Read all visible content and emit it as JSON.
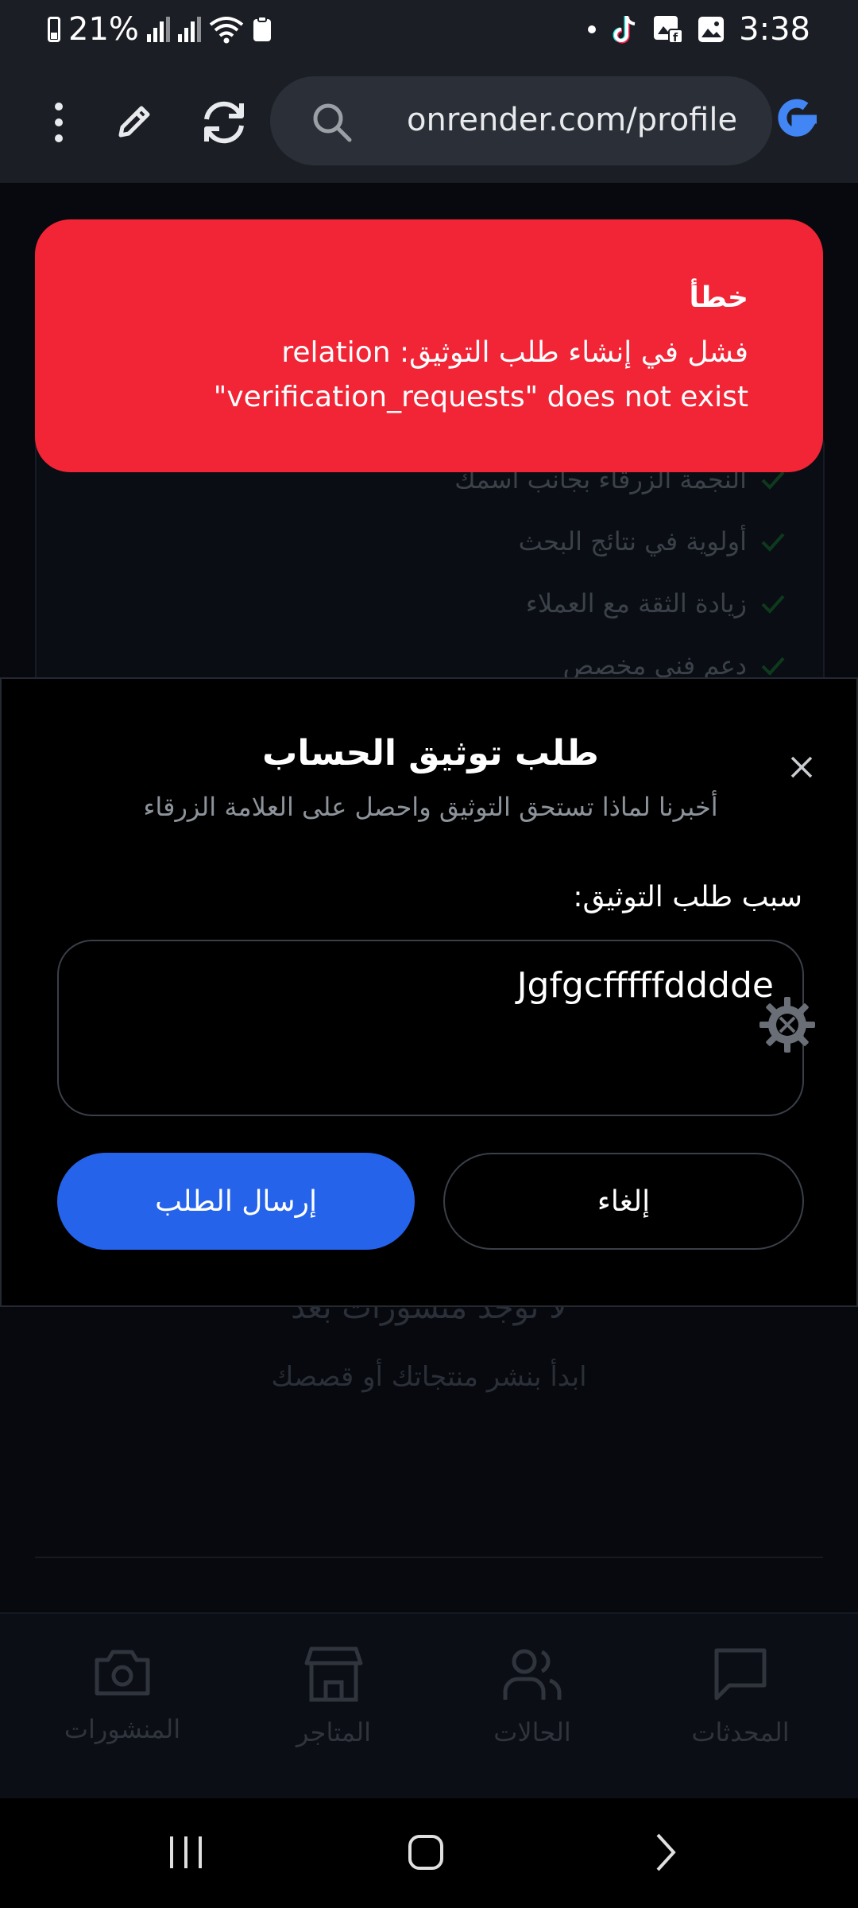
{
  "status_bar": {
    "battery": "21%",
    "time": "3:38",
    "icons": [
      "battery-icon",
      "signal-icon",
      "signal-icon",
      "wifi-icon",
      "clipboard-icon",
      "notification-dot",
      "tiktok-icon",
      "facebook-gallery-icon",
      "gallery-icon"
    ]
  },
  "browser": {
    "url": "onrender.com/profile",
    "icons": [
      "more-vert-icon",
      "edit-pencil-icon",
      "refresh-icon",
      "search-icon",
      "google-icon"
    ]
  },
  "background_page": {
    "benefits": [
      "النجمة الزرقاء بجانب اسمك",
      "أولوية في نتائج البحث",
      "زيادة الثقة مع العملاء",
      "دعم فني مخصص"
    ],
    "empty_title": "لا توجد منشورات بعد",
    "empty_subtitle": "ابدأ بنشر منتجاتك أو قصصك"
  },
  "toast": {
    "title": "خطأ",
    "message": "فشل في إنشاء طلب التوثيق: relation \"verification_requests\" does not exist",
    "color": "#f12536"
  },
  "modal": {
    "title": "طلب توثيق الحساب",
    "subtitle": "أخبرنا لماذا تستحق التوثيق واحصل على العلامة الزرقاء",
    "field_label": "سبب طلب التوثيق:",
    "field_value": "Jgfgcfffffdddde",
    "submit_label": "إرسال الطلب",
    "cancel_label": "إلغاء",
    "accent_color": "#2563eb"
  },
  "app_nav": {
    "items": [
      {
        "label": "المنشورات",
        "icon": "camera-icon"
      },
      {
        "label": "المتاجر",
        "icon": "store-icon"
      },
      {
        "label": "الحالات",
        "icon": "users-icon"
      },
      {
        "label": "المحدثات",
        "icon": "chat-icon"
      }
    ]
  },
  "system_nav": {
    "icons": [
      "recents-icon",
      "home-icon",
      "back-icon"
    ]
  }
}
